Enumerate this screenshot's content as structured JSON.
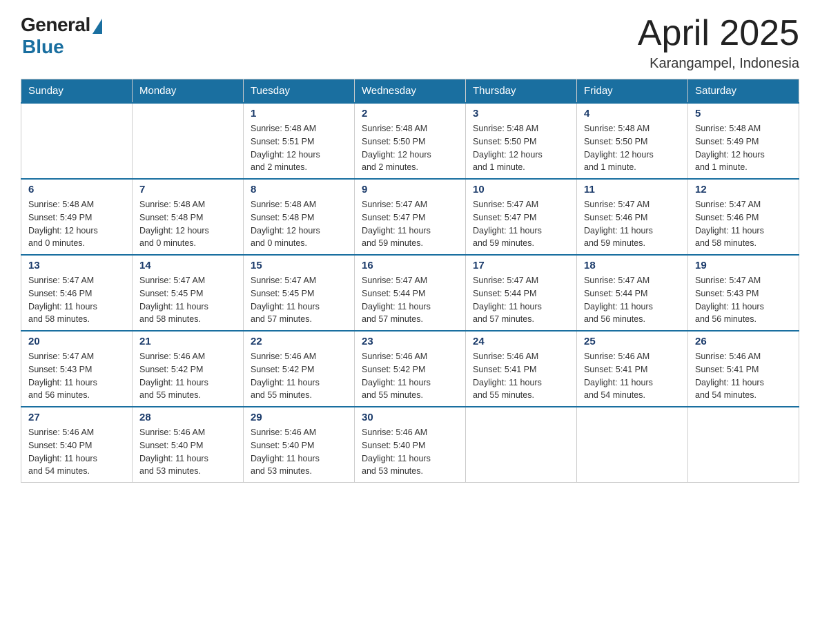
{
  "header": {
    "logo_general": "General",
    "logo_blue": "Blue",
    "month_title": "April 2025",
    "location": "Karangampel, Indonesia"
  },
  "weekdays": [
    "Sunday",
    "Monday",
    "Tuesday",
    "Wednesday",
    "Thursday",
    "Friday",
    "Saturday"
  ],
  "weeks": [
    [
      {
        "day": "",
        "info": ""
      },
      {
        "day": "",
        "info": ""
      },
      {
        "day": "1",
        "info": "Sunrise: 5:48 AM\nSunset: 5:51 PM\nDaylight: 12 hours\nand 2 minutes."
      },
      {
        "day": "2",
        "info": "Sunrise: 5:48 AM\nSunset: 5:50 PM\nDaylight: 12 hours\nand 2 minutes."
      },
      {
        "day": "3",
        "info": "Sunrise: 5:48 AM\nSunset: 5:50 PM\nDaylight: 12 hours\nand 1 minute."
      },
      {
        "day": "4",
        "info": "Sunrise: 5:48 AM\nSunset: 5:50 PM\nDaylight: 12 hours\nand 1 minute."
      },
      {
        "day": "5",
        "info": "Sunrise: 5:48 AM\nSunset: 5:49 PM\nDaylight: 12 hours\nand 1 minute."
      }
    ],
    [
      {
        "day": "6",
        "info": "Sunrise: 5:48 AM\nSunset: 5:49 PM\nDaylight: 12 hours\nand 0 minutes."
      },
      {
        "day": "7",
        "info": "Sunrise: 5:48 AM\nSunset: 5:48 PM\nDaylight: 12 hours\nand 0 minutes."
      },
      {
        "day": "8",
        "info": "Sunrise: 5:48 AM\nSunset: 5:48 PM\nDaylight: 12 hours\nand 0 minutes."
      },
      {
        "day": "9",
        "info": "Sunrise: 5:47 AM\nSunset: 5:47 PM\nDaylight: 11 hours\nand 59 minutes."
      },
      {
        "day": "10",
        "info": "Sunrise: 5:47 AM\nSunset: 5:47 PM\nDaylight: 11 hours\nand 59 minutes."
      },
      {
        "day": "11",
        "info": "Sunrise: 5:47 AM\nSunset: 5:46 PM\nDaylight: 11 hours\nand 59 minutes."
      },
      {
        "day": "12",
        "info": "Sunrise: 5:47 AM\nSunset: 5:46 PM\nDaylight: 11 hours\nand 58 minutes."
      }
    ],
    [
      {
        "day": "13",
        "info": "Sunrise: 5:47 AM\nSunset: 5:46 PM\nDaylight: 11 hours\nand 58 minutes."
      },
      {
        "day": "14",
        "info": "Sunrise: 5:47 AM\nSunset: 5:45 PM\nDaylight: 11 hours\nand 58 minutes."
      },
      {
        "day": "15",
        "info": "Sunrise: 5:47 AM\nSunset: 5:45 PM\nDaylight: 11 hours\nand 57 minutes."
      },
      {
        "day": "16",
        "info": "Sunrise: 5:47 AM\nSunset: 5:44 PM\nDaylight: 11 hours\nand 57 minutes."
      },
      {
        "day": "17",
        "info": "Sunrise: 5:47 AM\nSunset: 5:44 PM\nDaylight: 11 hours\nand 57 minutes."
      },
      {
        "day": "18",
        "info": "Sunrise: 5:47 AM\nSunset: 5:44 PM\nDaylight: 11 hours\nand 56 minutes."
      },
      {
        "day": "19",
        "info": "Sunrise: 5:47 AM\nSunset: 5:43 PM\nDaylight: 11 hours\nand 56 minutes."
      }
    ],
    [
      {
        "day": "20",
        "info": "Sunrise: 5:47 AM\nSunset: 5:43 PM\nDaylight: 11 hours\nand 56 minutes."
      },
      {
        "day": "21",
        "info": "Sunrise: 5:46 AM\nSunset: 5:42 PM\nDaylight: 11 hours\nand 55 minutes."
      },
      {
        "day": "22",
        "info": "Sunrise: 5:46 AM\nSunset: 5:42 PM\nDaylight: 11 hours\nand 55 minutes."
      },
      {
        "day": "23",
        "info": "Sunrise: 5:46 AM\nSunset: 5:42 PM\nDaylight: 11 hours\nand 55 minutes."
      },
      {
        "day": "24",
        "info": "Sunrise: 5:46 AM\nSunset: 5:41 PM\nDaylight: 11 hours\nand 55 minutes."
      },
      {
        "day": "25",
        "info": "Sunrise: 5:46 AM\nSunset: 5:41 PM\nDaylight: 11 hours\nand 54 minutes."
      },
      {
        "day": "26",
        "info": "Sunrise: 5:46 AM\nSunset: 5:41 PM\nDaylight: 11 hours\nand 54 minutes."
      }
    ],
    [
      {
        "day": "27",
        "info": "Sunrise: 5:46 AM\nSunset: 5:40 PM\nDaylight: 11 hours\nand 54 minutes."
      },
      {
        "day": "28",
        "info": "Sunrise: 5:46 AM\nSunset: 5:40 PM\nDaylight: 11 hours\nand 53 minutes."
      },
      {
        "day": "29",
        "info": "Sunrise: 5:46 AM\nSunset: 5:40 PM\nDaylight: 11 hours\nand 53 minutes."
      },
      {
        "day": "30",
        "info": "Sunrise: 5:46 AM\nSunset: 5:40 PM\nDaylight: 11 hours\nand 53 minutes."
      },
      {
        "day": "",
        "info": ""
      },
      {
        "day": "",
        "info": ""
      },
      {
        "day": "",
        "info": ""
      }
    ]
  ]
}
